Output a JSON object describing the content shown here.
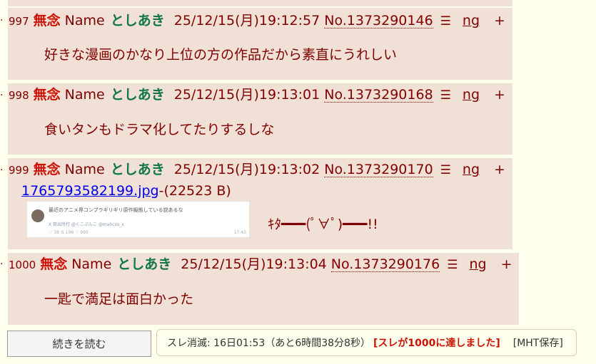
{
  "posts": [
    {
      "number": "997",
      "subject": "無念",
      "name_label": "Name",
      "author": "としあき",
      "date": "25/12/15(月)19:12:57",
      "post_no": "No.1373290146",
      "ng": "ng",
      "plus": "+",
      "body": "好きな漫画のかなり上位の方の作品だから素直にうれしい"
    },
    {
      "number": "998",
      "subject": "無念",
      "name_label": "Name",
      "author": "としあき",
      "date": "25/12/15(月)19:13:01",
      "post_no": "No.1373290168",
      "ng": "ng",
      "plus": "+",
      "body": "食いタンもドラマ化してたりするしな"
    },
    {
      "number": "999",
      "subject": "無念",
      "name_label": "Name",
      "author": "としあき",
      "date": "25/12/15(月)19:13:02",
      "post_no": "No.1373290170",
      "ng": "ng",
      "plus": "+",
      "file_name": "1765793582199.jpg",
      "file_size": "-(22523 B)",
      "thumb_text": "最近のアニメ界コンプラギリギリ原作擬態している説あるな",
      "thumb_user": "X  筒出所打 @くこぷんこ @mahcos_x",
      "thumb_stats": "♡ 38   ⇅ 196   ♡ 995",
      "thumb_time": "17:43",
      "body": "ｷﾀ━━━(ﾟ∀ﾟ)━━━!!"
    },
    {
      "number": "1000",
      "subject": "無念",
      "name_label": "Name",
      "author": "としあき",
      "date": "25/12/15(月)19:13:04",
      "post_no": "No.1373290176",
      "ng": "ng",
      "plus": "+",
      "body": "一匙で満足は面白かった"
    }
  ],
  "post_dot": "·",
  "menu_icon": "list-icon",
  "menu_glyph": "☰",
  "footer": {
    "continue_label": "続きを読む",
    "status_text": "スレ消滅: 16日01:53（あと6時間38分8秒）",
    "status_alert": "[スレが1000に達しました]",
    "mht_label": "[MHT保存]"
  },
  "colors": {
    "page_bg": "#ffffee",
    "post_bg": "#f0e0d6",
    "text": "#800000",
    "subject": "#cc1105",
    "author": "#117743",
    "link": "#0000ee"
  }
}
